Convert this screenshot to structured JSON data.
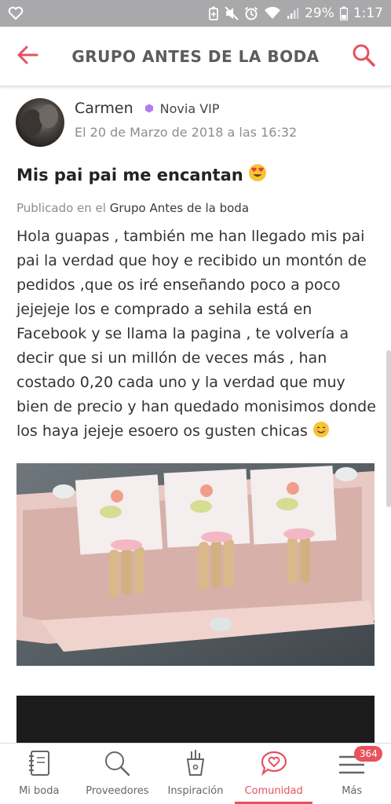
{
  "status_bar": {
    "battery": "29%",
    "time": "1:17",
    "icons": [
      "heart-icon",
      "battery-saver-icon",
      "mute-icon",
      "alarm-icon",
      "wifi-icon",
      "signal-icon",
      "battery-icon"
    ]
  },
  "app_bar": {
    "title": "GRUPO ANTES DE LA BODA",
    "accent": "#e5525f"
  },
  "post": {
    "author": "Carmen",
    "badge": "Novia VIP",
    "badge_color": "#b57bea",
    "date": "El 20 de Marzo de 2018 a las 16:32",
    "title": "Mis pai pai me encantan",
    "published_prefix": "Publicado en el",
    "group": "Grupo Antes de la boda",
    "body": "Hola guapas , también me han llegado mis pai pai la verdad que hoy e recibido un montón de pedidos ,que os iré enseñando poco a poco jejejeje los e comprado a sehila está en Facebook y se llama la pagina , te volvería a decir que si un millón de veces más , han costado 0,20 cada uno y la verdad que muy bien de precio y han quedado monisimos donde los haya jejeje esoero os gusten chicas"
  },
  "bottom_nav": {
    "items": [
      {
        "label": "Mi boda",
        "icon": "notebook-icon"
      },
      {
        "label": "Proveedores",
        "icon": "search-icon"
      },
      {
        "label": "Inspiración",
        "icon": "paint-cup-icon"
      },
      {
        "label": "Comunidad",
        "icon": "heart-chat-icon"
      },
      {
        "label": "Más",
        "icon": "menu-icon"
      }
    ],
    "active": "Comunidad",
    "badge": "364"
  }
}
